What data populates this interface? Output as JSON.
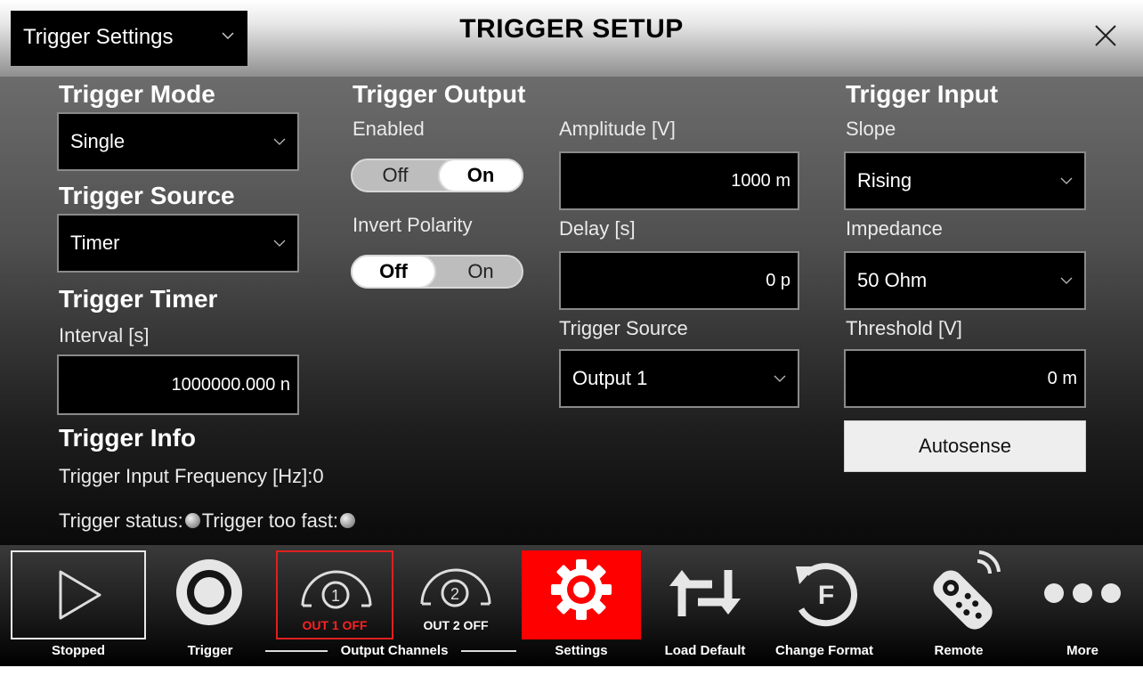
{
  "header": {
    "preset_selector": "Trigger Settings",
    "title": "TRIGGER SETUP"
  },
  "trigger_mode": {
    "heading": "Trigger Mode",
    "value": "Single"
  },
  "trigger_source": {
    "heading": "Trigger Source",
    "value": "Timer"
  },
  "trigger_timer": {
    "heading": "Trigger Timer",
    "interval_label": "Interval [s]",
    "interval_value": "1000000.000 n"
  },
  "trigger_info": {
    "heading": "Trigger Info",
    "input_frequency_label": "Trigger Input Frequency  [Hz]:",
    "input_frequency_value": "0",
    "status_label": "Trigger status:",
    "too_fast_label": "Trigger too fast:"
  },
  "trigger_output": {
    "heading": "Trigger Output",
    "enabled_label": "Enabled",
    "enabled_off": "Off",
    "enabled_on": "On",
    "enabled_state": "On",
    "invert_label": "Invert Polarity",
    "invert_off": "Off",
    "invert_on": "On",
    "invert_state": "Off",
    "amplitude_label": "Amplitude [V]",
    "amplitude_value": "1000 m",
    "delay_label": "Delay [s]",
    "delay_value": "0 p",
    "source_label": "Trigger Source",
    "source_value": "Output 1"
  },
  "trigger_input": {
    "heading": "Trigger Input",
    "slope_label": "Slope",
    "slope_value": "Rising",
    "impedance_label": "Impedance",
    "impedance_value": "50 Ohm",
    "threshold_label": "Threshold [V]",
    "threshold_value": "0 m",
    "autosense_label": "Autosense"
  },
  "toolbar": {
    "stopped": "Stopped",
    "trigger": "Trigger",
    "output_channels": "Output Channels",
    "out1_number": "1",
    "out1_status": "OUT 1 OFF",
    "out2_number": "2",
    "out2_status": "OUT 2 OFF",
    "settings": "Settings",
    "load_default": "Load Default",
    "change_format": "Change Format",
    "change_format_icon_letter": "F",
    "remote": "Remote",
    "more": "More"
  },
  "colors": {
    "accent_red": "#ff1a1a",
    "out1_status": "#ff2020",
    "active_settings_bg": "#ff0000"
  },
  "icons": [
    "chevron-down-icon",
    "close-icon",
    "play-icon",
    "record-icon",
    "channel-1-icon",
    "channel-2-icon",
    "gear-icon",
    "load-default-icon",
    "change-format-icon",
    "remote-control-icon",
    "more-icon"
  ]
}
